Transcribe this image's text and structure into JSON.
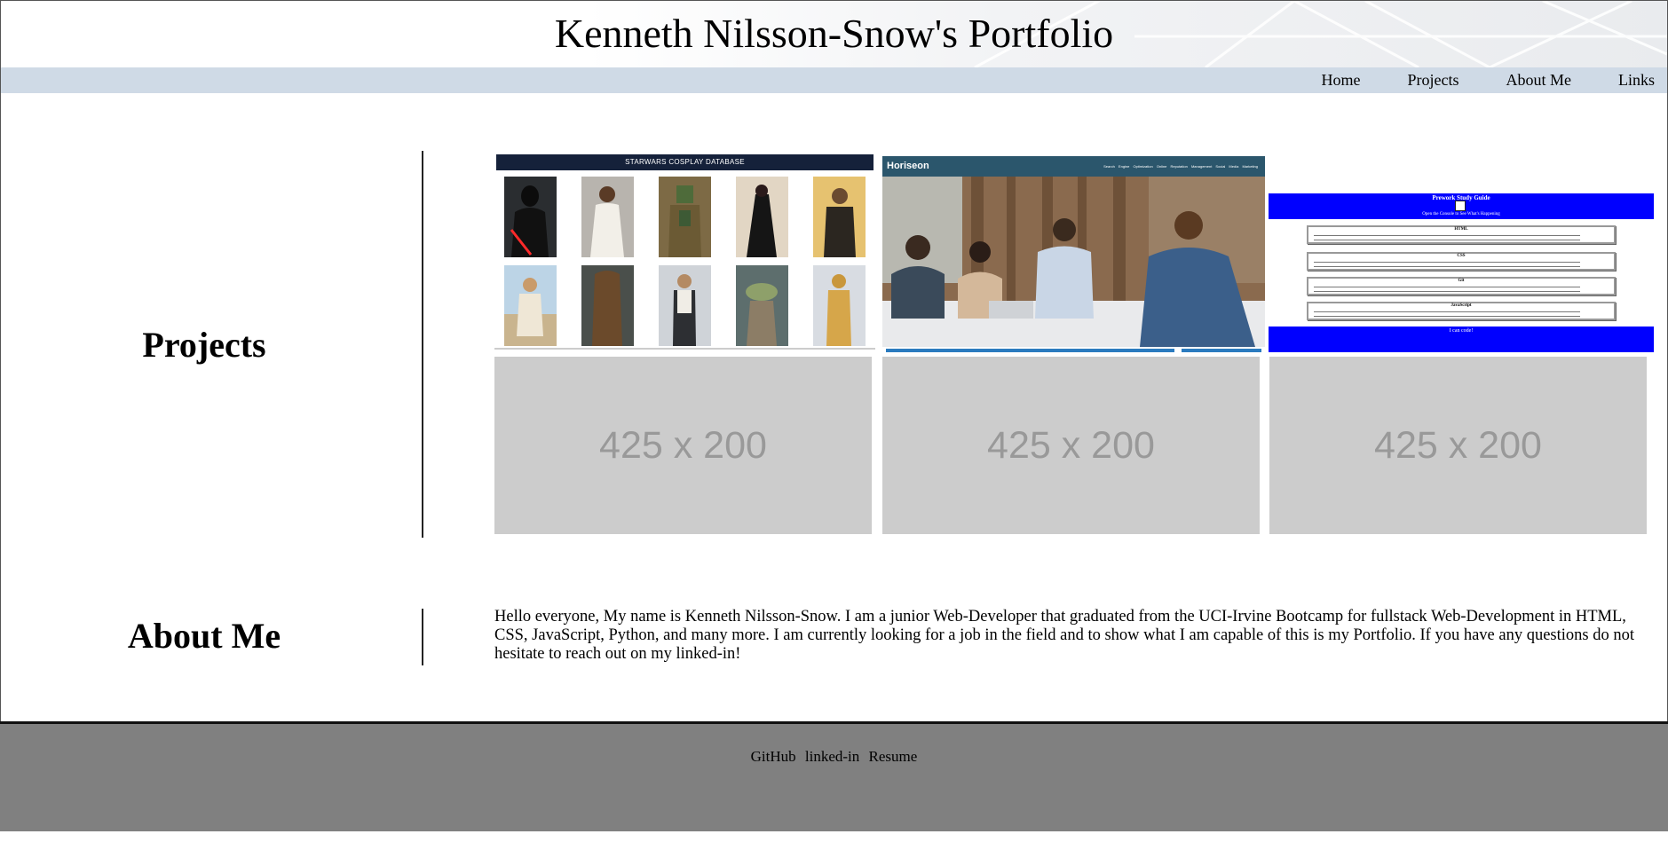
{
  "header": {
    "title": "Kenneth Nilsson-Snow's Portfolio"
  },
  "nav": {
    "items": [
      "Home",
      "Projects",
      "About Me",
      "Links"
    ]
  },
  "projects": {
    "heading": "Projects",
    "starwars": {
      "banner": "STARWARS COSPLAY DATABASE"
    },
    "horiseon": {
      "logo": "Horiseon",
      "links": "Search Engine Optimization   Online Reputation Management   Social Media Marketing"
    },
    "prework": {
      "title": "Prework Study Guide",
      "subtitle": "Open the Console to See What's Happening",
      "cards": [
        "HTML",
        "CSS",
        "Git",
        "JavaScript"
      ],
      "footer": "I can code!"
    },
    "placeholders": [
      "425 x 200",
      "425 x 200",
      "425 x 200"
    ]
  },
  "about": {
    "heading": "About Me",
    "text": "Hello everyone, My name is Kenneth Nilsson-Snow. I am a junior Web-Developer that graduated from the UCI-Irvine Bootcamp for fullstack Web-Development in HTML, CSS, JavaScript, Python, and many more. I am currently looking for a job in the field and to show what I am capable of this is my Portfolio. If you have any questions do not hesitate to reach out on my linked-in!"
  },
  "footer": {
    "links": [
      "GitHub",
      "linked-in",
      "Resume"
    ]
  },
  "colors": {
    "nav_bg": "#cfdae6",
    "footer_bg": "#808080",
    "placeholder_bg": "#cccccc",
    "prework_blue": "#0000ff",
    "horiseon_bar": "#2b566c"
  }
}
